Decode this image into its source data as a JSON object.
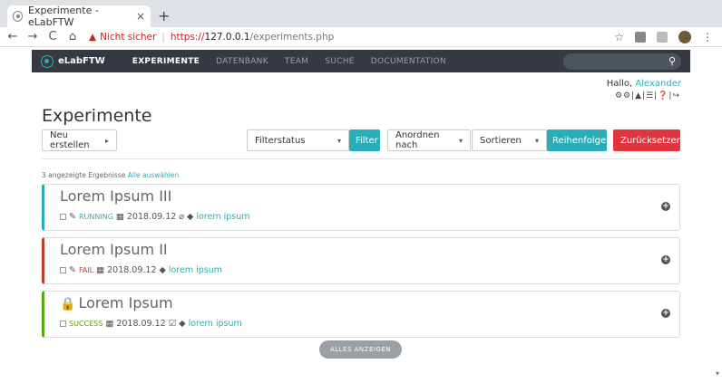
{
  "browser": {
    "tab_title": "Experimente - eLabFTW",
    "close": "×",
    "newtab": "+",
    "back": "←",
    "forward": "→",
    "reload": "C",
    "home": "⌂",
    "warning_icon": "▲",
    "not_secure": "Nicht sicher",
    "separator": "|",
    "url_proto": "https://",
    "url_host": "127.0.0.1",
    "url_path": "/experiments.php",
    "star": "☆",
    "menu": "⋮"
  },
  "nav": {
    "brand": "eLabFTW",
    "links": [
      "EXPERIMENTE",
      "DATENBANK",
      "TEAM",
      "SUCHE",
      "DOCUMENTATION"
    ],
    "search_icon": "⚲"
  },
  "user": {
    "greeting": "Hallo,",
    "name": "Alexander",
    "icons": "⚙⚙|▲|☰|❓|↪"
  },
  "page": {
    "title": "Experimente",
    "create_label": "Neu erstellen",
    "create_caret": "▸",
    "filter_select": "Filterstatus",
    "filter_button": "Filter",
    "order_by": "Anordnen nach",
    "sort_select": "Sortieren",
    "order_button": "Reihenfolge",
    "reset_button": "Zurücksetzen",
    "caret": "▾",
    "count_text": "3 angezeigte Ergebnisse",
    "select_all": "Alle auswählen",
    "show_all": "ALLES ANZEIGEN"
  },
  "experiments": [
    {
      "title": "Lorem Ipsum III",
      "status": "RUNNING",
      "date": "2018.09.12",
      "tag": "lorem ipsum",
      "color": "#29aeb9",
      "locked": false
    },
    {
      "title": "Lorem Ipsum II",
      "status": "FAIL",
      "date": "2018.09.12",
      "tag": "lorem ipsum",
      "color": "#c0392b",
      "locked": false
    },
    {
      "title": "Lorem Ipsum",
      "status": "SUCCESS",
      "date": "2018.09.12",
      "tag": "lorem ipsum",
      "color": "#54aa08",
      "locked": true
    }
  ],
  "glyphs": {
    "pencil": "✎",
    "calendar": "▦",
    "clip": "⌀",
    "tag_icon": "◆",
    "check_doc": "☑",
    "plus": "+",
    "lock": "🔒",
    "scroll_down": "▾"
  }
}
